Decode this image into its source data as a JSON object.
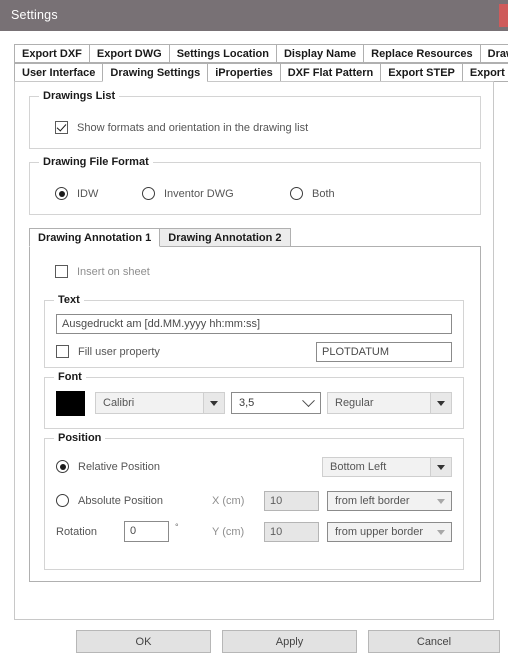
{
  "window": {
    "title": "Settings",
    "close_icon": "close-icon",
    "titlebar_color": "#787175",
    "close_color": "#ce5b5b"
  },
  "tabs": {
    "row1": [
      {
        "label": "Export DXF",
        "active": false
      },
      {
        "label": "Export DWG",
        "active": false
      },
      {
        "label": "Settings Location",
        "active": false
      },
      {
        "label": "Display Name",
        "active": false
      },
      {
        "label": "Replace Resources",
        "active": false
      },
      {
        "label": "Drawing functions",
        "active": false
      }
    ],
    "row2": [
      {
        "label": "User Interface",
        "active": false
      },
      {
        "label": "Drawing Settings",
        "active": true
      },
      {
        "label": "iProperties",
        "active": false
      },
      {
        "label": "DXF Flat Pattern",
        "active": false
      },
      {
        "label": "Export STEP",
        "active": false
      },
      {
        "label": "Export PDF",
        "active": false
      }
    ]
  },
  "drawings_list": {
    "group_title": "Drawings List",
    "show_formats": {
      "label": "Show formats and orientation in the drawing list",
      "checked": true
    }
  },
  "file_format": {
    "group_title": "Drawing File Format",
    "options": [
      {
        "label": "IDW",
        "selected": true
      },
      {
        "label": "Inventor DWG",
        "selected": false
      },
      {
        "label": "Both",
        "selected": false
      }
    ]
  },
  "annotation": {
    "tabs": [
      {
        "label": "Drawing Annotation 1",
        "active": true
      },
      {
        "label": "Drawing Annotation 2",
        "active": false
      }
    ],
    "insert_on_sheet": {
      "label": "Insert on sheet",
      "checked": false
    },
    "text": {
      "group_title": "Text",
      "value": "Ausgedruckt am [dd.MM.yyyy hh:mm:ss]",
      "fill_user_property": {
        "label": "Fill user property",
        "checked": false
      },
      "user_property_value": "PLOTDATUM"
    },
    "font": {
      "group_title": "Font",
      "color": "#000000",
      "family": "Calibri",
      "size": "3,5",
      "style": "Regular"
    },
    "position": {
      "group_title": "Position",
      "relative": {
        "label": "Relative Position",
        "selected": true
      },
      "relative_value": "Bottom Left",
      "absolute": {
        "label": "Absolute Position",
        "selected": false
      },
      "rotation_label": "Rotation",
      "rotation_value": "0",
      "degree_symbol": "°",
      "x_label": "X (cm)",
      "x_value": "10",
      "x_reference": "from left border",
      "y_label": "Y (cm)",
      "y_value": "10",
      "y_reference": "from upper border"
    }
  },
  "footer": {
    "ok": "OK",
    "apply": "Apply",
    "cancel": "Cancel"
  }
}
